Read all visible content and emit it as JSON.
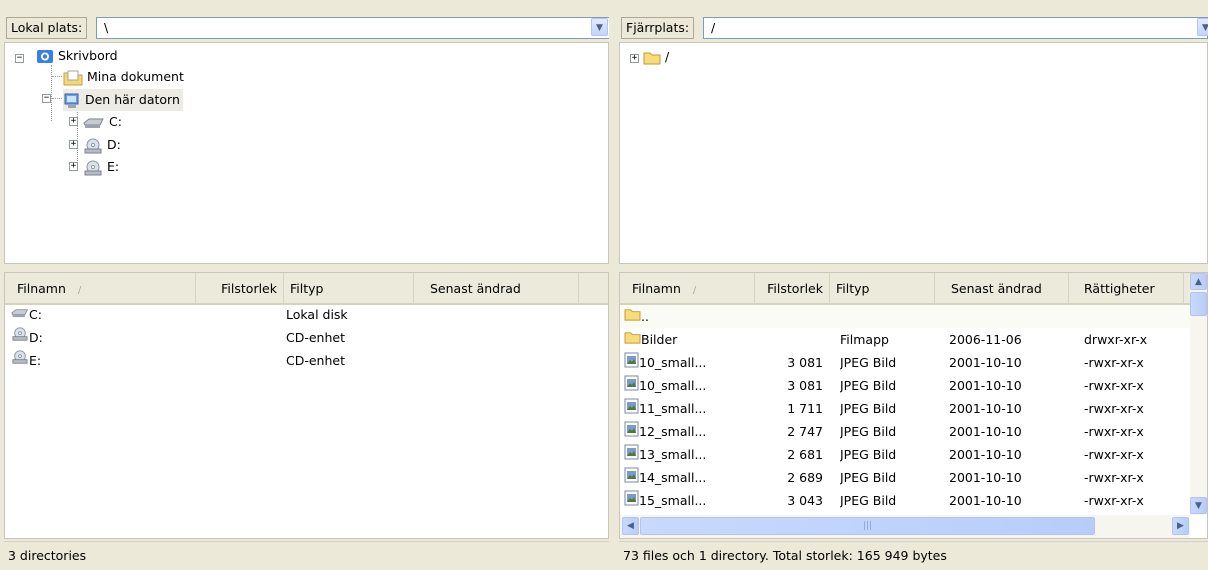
{
  "local": {
    "location_label": "Lokal plats:",
    "location_value": "\\",
    "tree": [
      {
        "label": "Skrivbord",
        "icon": "desktop-icon"
      },
      {
        "label": "Mina dokument",
        "icon": "documents-folder-icon"
      },
      {
        "label": "Den här datorn",
        "icon": "my-computer-icon"
      },
      {
        "label": "C:",
        "icon": "hard-disk-icon"
      },
      {
        "label": "D:",
        "icon": "cd-drive-icon"
      },
      {
        "label": "E:",
        "icon": "cd-drive-icon"
      }
    ],
    "columns": {
      "name": "Filnamn",
      "size": "Filstorlek",
      "type": "Filtyp",
      "modified": "Senast ändrad",
      "sort_indicator": "/"
    },
    "files": [
      {
        "name": "C:",
        "type": "Lokal disk",
        "icon": "hard-disk-icon"
      },
      {
        "name": "D:",
        "type": "CD-enhet",
        "icon": "cd-drive-icon"
      },
      {
        "name": "E:",
        "type": "CD-enhet",
        "icon": "cd-drive-icon"
      }
    ],
    "status": "3 directories"
  },
  "remote": {
    "location_label": "Fjärrplats:",
    "location_value": "/",
    "tree": [
      {
        "label": "/",
        "icon": "folder-icon"
      }
    ],
    "columns": {
      "name": "Filnamn",
      "size": "Filstorlek",
      "type": "Filtyp",
      "modified": "Senast ändrad",
      "perms": "Rättigheter",
      "sort_indicator": "/"
    },
    "files": [
      {
        "name": "..",
        "size": "",
        "type": "",
        "modified": "",
        "perms": "",
        "icon": "folder-icon"
      },
      {
        "name": "Bilder",
        "size": "",
        "type": "Filmapp",
        "modified": "2006-11-06",
        "perms": "drwxr-xr-x",
        "icon": "folder-icon"
      },
      {
        "name": "10_small...",
        "size": "3 081",
        "type": "JPEG Bild",
        "modified": "2001-10-10",
        "perms": "-rwxr-xr-x",
        "icon": "image-file-icon"
      },
      {
        "name": "10_small...",
        "size": "3 081",
        "type": "JPEG Bild",
        "modified": "2001-10-10",
        "perms": "-rwxr-xr-x",
        "icon": "image-file-icon"
      },
      {
        "name": "11_small...",
        "size": "1 711",
        "type": "JPEG Bild",
        "modified": "2001-10-10",
        "perms": "-rwxr-xr-x",
        "icon": "image-file-icon"
      },
      {
        "name": "12_small...",
        "size": "2 747",
        "type": "JPEG Bild",
        "modified": "2001-10-10",
        "perms": "-rwxr-xr-x",
        "icon": "image-file-icon"
      },
      {
        "name": "13_small...",
        "size": "2 681",
        "type": "JPEG Bild",
        "modified": "2001-10-10",
        "perms": "-rwxr-xr-x",
        "icon": "image-file-icon"
      },
      {
        "name": "14_small...",
        "size": "2 689",
        "type": "JPEG Bild",
        "modified": "2001-10-10",
        "perms": "-rwxr-xr-x",
        "icon": "image-file-icon"
      },
      {
        "name": "15_small...",
        "size": "3 043",
        "type": "JPEG Bild",
        "modified": "2001-10-10",
        "perms": "-rwxr-xr-x",
        "icon": "image-file-icon"
      }
    ],
    "status": "73 files och 1 directory. Total storlek: 165 949 bytes"
  }
}
